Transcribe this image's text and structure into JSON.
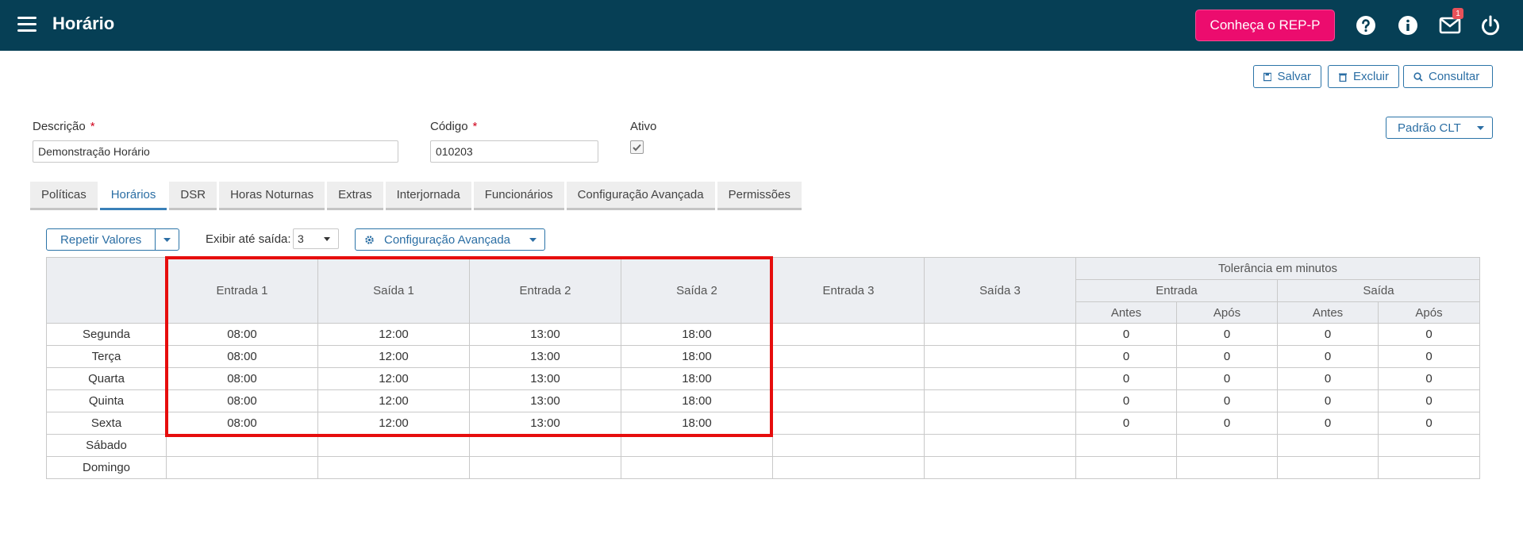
{
  "header": {
    "title": "Horário",
    "promo_label": "Conheça o REP-P",
    "notification_count": "1",
    "brand_color": "#063f55",
    "accent_color": "#ec0c6e",
    "icons": [
      "menu-icon",
      "help-icon",
      "info-icon",
      "mail-icon",
      "power-icon"
    ]
  },
  "actions": {
    "save_label": "Salvar",
    "delete_label": "Excluir",
    "search_label": "Consultar"
  },
  "form": {
    "description_label": "Descrição",
    "description_value": "Demonstração Horário",
    "code_label": "Código",
    "code_value": "010203",
    "active_label": "Ativo",
    "active_checked": true,
    "required_mark": "*",
    "preset_label": "Padrão CLT"
  },
  "tabs": [
    {
      "label": "Políticas",
      "active": false
    },
    {
      "label": "Horários",
      "active": true
    },
    {
      "label": "DSR",
      "active": false
    },
    {
      "label": "Horas Noturnas",
      "active": false
    },
    {
      "label": "Extras",
      "active": false
    },
    {
      "label": "Interjornada",
      "active": false
    },
    {
      "label": "Funcionários",
      "active": false
    },
    {
      "label": "Configuração Avançada",
      "active": false
    },
    {
      "label": "Permissões",
      "active": false
    }
  ],
  "toolbar": {
    "repeat_label": "Repetir Valores",
    "show_until_label": "Exibir até saída:",
    "show_until_value": "3",
    "advanced_label": "Configuração Avançada"
  },
  "grid": {
    "columns": [
      "Entrada 1",
      "Saída 1",
      "Entrada 2",
      "Saída 2",
      "Entrada 3",
      "Saída 3"
    ],
    "tolerance_header": "Tolerância em minutos",
    "tolerance_groups": [
      "Entrada",
      "Saída"
    ],
    "tolerance_sub": [
      "Antes",
      "Após",
      "Antes",
      "Após"
    ],
    "rows": [
      {
        "day": "Segunda",
        "cells": [
          "08:00",
          "12:00",
          "13:00",
          "18:00",
          "",
          "",
          "0",
          "0",
          "0",
          "0"
        ]
      },
      {
        "day": "Terça",
        "cells": [
          "08:00",
          "12:00",
          "13:00",
          "18:00",
          "",
          "",
          "0",
          "0",
          "0",
          "0"
        ]
      },
      {
        "day": "Quarta",
        "cells": [
          "08:00",
          "12:00",
          "13:00",
          "18:00",
          "",
          "",
          "0",
          "0",
          "0",
          "0"
        ]
      },
      {
        "day": "Quinta",
        "cells": [
          "08:00",
          "12:00",
          "13:00",
          "18:00",
          "",
          "",
          "0",
          "0",
          "0",
          "0"
        ]
      },
      {
        "day": "Sexta",
        "cells": [
          "08:00",
          "12:00",
          "13:00",
          "18:00",
          "",
          "",
          "0",
          "0",
          "0",
          "0"
        ]
      },
      {
        "day": "Sábado",
        "cells": [
          "",
          "",
          "",
          "",
          "",
          "",
          "",
          "",
          "",
          ""
        ]
      },
      {
        "day": "Domingo",
        "cells": [
          "",
          "",
          "",
          "",
          "",
          "",
          "",
          "",
          "",
          ""
        ]
      }
    ]
  }
}
